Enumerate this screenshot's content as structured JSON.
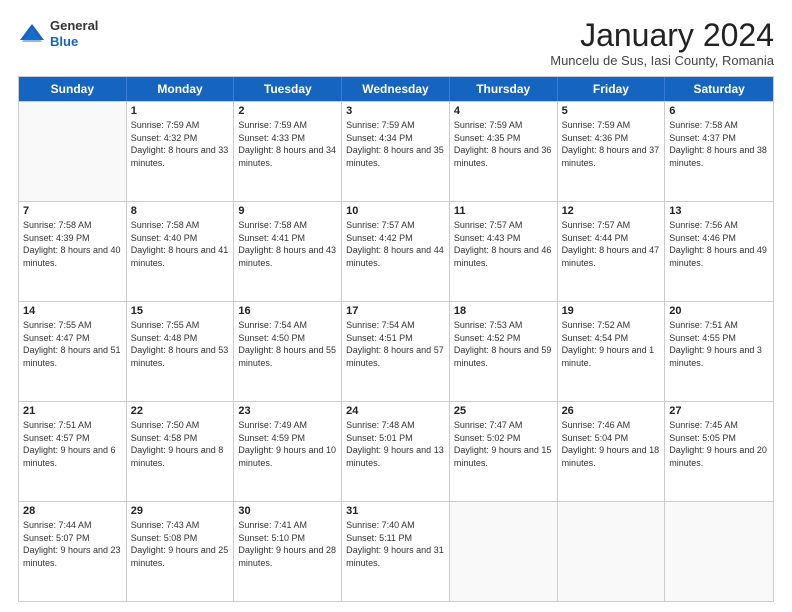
{
  "header": {
    "logo": {
      "general": "General",
      "blue": "Blue"
    },
    "title": "January 2024",
    "subtitle": "Muncelu de Sus, Iasi County, Romania"
  },
  "days_of_week": [
    "Sunday",
    "Monday",
    "Tuesday",
    "Wednesday",
    "Thursday",
    "Friday",
    "Saturday"
  ],
  "weeks": [
    [
      {
        "num": "",
        "sunrise": "",
        "sunset": "",
        "daylight": "",
        "empty": true
      },
      {
        "num": "1",
        "sunrise": "Sunrise: 7:59 AM",
        "sunset": "Sunset: 4:32 PM",
        "daylight": "Daylight: 8 hours and 33 minutes."
      },
      {
        "num": "2",
        "sunrise": "Sunrise: 7:59 AM",
        "sunset": "Sunset: 4:33 PM",
        "daylight": "Daylight: 8 hours and 34 minutes."
      },
      {
        "num": "3",
        "sunrise": "Sunrise: 7:59 AM",
        "sunset": "Sunset: 4:34 PM",
        "daylight": "Daylight: 8 hours and 35 minutes."
      },
      {
        "num": "4",
        "sunrise": "Sunrise: 7:59 AM",
        "sunset": "Sunset: 4:35 PM",
        "daylight": "Daylight: 8 hours and 36 minutes."
      },
      {
        "num": "5",
        "sunrise": "Sunrise: 7:59 AM",
        "sunset": "Sunset: 4:36 PM",
        "daylight": "Daylight: 8 hours and 37 minutes."
      },
      {
        "num": "6",
        "sunrise": "Sunrise: 7:58 AM",
        "sunset": "Sunset: 4:37 PM",
        "daylight": "Daylight: 8 hours and 38 minutes."
      }
    ],
    [
      {
        "num": "7",
        "sunrise": "Sunrise: 7:58 AM",
        "sunset": "Sunset: 4:39 PM",
        "daylight": "Daylight: 8 hours and 40 minutes."
      },
      {
        "num": "8",
        "sunrise": "Sunrise: 7:58 AM",
        "sunset": "Sunset: 4:40 PM",
        "daylight": "Daylight: 8 hours and 41 minutes."
      },
      {
        "num": "9",
        "sunrise": "Sunrise: 7:58 AM",
        "sunset": "Sunset: 4:41 PM",
        "daylight": "Daylight: 8 hours and 43 minutes."
      },
      {
        "num": "10",
        "sunrise": "Sunrise: 7:57 AM",
        "sunset": "Sunset: 4:42 PM",
        "daylight": "Daylight: 8 hours and 44 minutes."
      },
      {
        "num": "11",
        "sunrise": "Sunrise: 7:57 AM",
        "sunset": "Sunset: 4:43 PM",
        "daylight": "Daylight: 8 hours and 46 minutes."
      },
      {
        "num": "12",
        "sunrise": "Sunrise: 7:57 AM",
        "sunset": "Sunset: 4:44 PM",
        "daylight": "Daylight: 8 hours and 47 minutes."
      },
      {
        "num": "13",
        "sunrise": "Sunrise: 7:56 AM",
        "sunset": "Sunset: 4:46 PM",
        "daylight": "Daylight: 8 hours and 49 minutes."
      }
    ],
    [
      {
        "num": "14",
        "sunrise": "Sunrise: 7:55 AM",
        "sunset": "Sunset: 4:47 PM",
        "daylight": "Daylight: 8 hours and 51 minutes."
      },
      {
        "num": "15",
        "sunrise": "Sunrise: 7:55 AM",
        "sunset": "Sunset: 4:48 PM",
        "daylight": "Daylight: 8 hours and 53 minutes."
      },
      {
        "num": "16",
        "sunrise": "Sunrise: 7:54 AM",
        "sunset": "Sunset: 4:50 PM",
        "daylight": "Daylight: 8 hours and 55 minutes."
      },
      {
        "num": "17",
        "sunrise": "Sunrise: 7:54 AM",
        "sunset": "Sunset: 4:51 PM",
        "daylight": "Daylight: 8 hours and 57 minutes."
      },
      {
        "num": "18",
        "sunrise": "Sunrise: 7:53 AM",
        "sunset": "Sunset: 4:52 PM",
        "daylight": "Daylight: 8 hours and 59 minutes."
      },
      {
        "num": "19",
        "sunrise": "Sunrise: 7:52 AM",
        "sunset": "Sunset: 4:54 PM",
        "daylight": "Daylight: 9 hours and 1 minute."
      },
      {
        "num": "20",
        "sunrise": "Sunrise: 7:51 AM",
        "sunset": "Sunset: 4:55 PM",
        "daylight": "Daylight: 9 hours and 3 minutes."
      }
    ],
    [
      {
        "num": "21",
        "sunrise": "Sunrise: 7:51 AM",
        "sunset": "Sunset: 4:57 PM",
        "daylight": "Daylight: 9 hours and 6 minutes."
      },
      {
        "num": "22",
        "sunrise": "Sunrise: 7:50 AM",
        "sunset": "Sunset: 4:58 PM",
        "daylight": "Daylight: 9 hours and 8 minutes."
      },
      {
        "num": "23",
        "sunrise": "Sunrise: 7:49 AM",
        "sunset": "Sunset: 4:59 PM",
        "daylight": "Daylight: 9 hours and 10 minutes."
      },
      {
        "num": "24",
        "sunrise": "Sunrise: 7:48 AM",
        "sunset": "Sunset: 5:01 PM",
        "daylight": "Daylight: 9 hours and 13 minutes."
      },
      {
        "num": "25",
        "sunrise": "Sunrise: 7:47 AM",
        "sunset": "Sunset: 5:02 PM",
        "daylight": "Daylight: 9 hours and 15 minutes."
      },
      {
        "num": "26",
        "sunrise": "Sunrise: 7:46 AM",
        "sunset": "Sunset: 5:04 PM",
        "daylight": "Daylight: 9 hours and 18 minutes."
      },
      {
        "num": "27",
        "sunrise": "Sunrise: 7:45 AM",
        "sunset": "Sunset: 5:05 PM",
        "daylight": "Daylight: 9 hours and 20 minutes."
      }
    ],
    [
      {
        "num": "28",
        "sunrise": "Sunrise: 7:44 AM",
        "sunset": "Sunset: 5:07 PM",
        "daylight": "Daylight: 9 hours and 23 minutes."
      },
      {
        "num": "29",
        "sunrise": "Sunrise: 7:43 AM",
        "sunset": "Sunset: 5:08 PM",
        "daylight": "Daylight: 9 hours and 25 minutes."
      },
      {
        "num": "30",
        "sunrise": "Sunrise: 7:41 AM",
        "sunset": "Sunset: 5:10 PM",
        "daylight": "Daylight: 9 hours and 28 minutes."
      },
      {
        "num": "31",
        "sunrise": "Sunrise: 7:40 AM",
        "sunset": "Sunset: 5:11 PM",
        "daylight": "Daylight: 9 hours and 31 minutes."
      },
      {
        "num": "",
        "sunrise": "",
        "sunset": "",
        "daylight": "",
        "empty": true
      },
      {
        "num": "",
        "sunrise": "",
        "sunset": "",
        "daylight": "",
        "empty": true
      },
      {
        "num": "",
        "sunrise": "",
        "sunset": "",
        "daylight": "",
        "empty": true
      }
    ]
  ]
}
